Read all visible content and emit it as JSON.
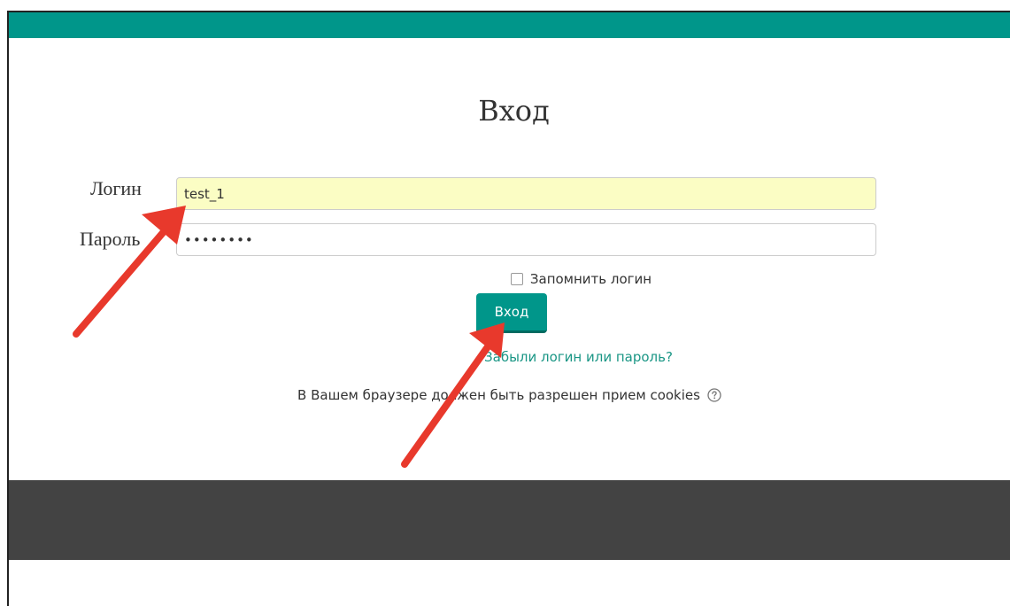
{
  "page": {
    "title": "Вход",
    "accent_color": "#00968a",
    "footer_color": "#434343"
  },
  "form": {
    "login_label": "Логин",
    "login_value": "test_1",
    "password_label": "Пароль",
    "password_value": "••••••••",
    "remember_label": "Запомнить логин",
    "remember_checked": false,
    "submit_label": "Вход",
    "forgot_link": "Забыли логин или пароль?",
    "cookies_notice": "В Вашем браузере должен быть разрешен прием cookies",
    "help_icon": "question-circle-icon"
  },
  "annotations": {
    "arrow_color": "#e8392c",
    "arrows": [
      "arrow-to-login-field",
      "arrow-to-login-button"
    ]
  }
}
